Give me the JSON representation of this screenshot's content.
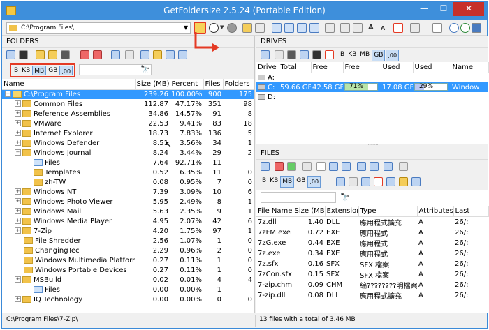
{
  "window": {
    "title": "GetFoldersize 2.5.24 (Portable Edition)",
    "minimize_glyph": "—",
    "maximize_glyph": "☐",
    "close_glyph": "✕"
  },
  "toolbar": {
    "path": "C:\\Program Files\\",
    "font_up": "A",
    "font_down": "A"
  },
  "folders_panel": {
    "title": "FOLDERS",
    "units": [
      "B",
      "KB",
      "MB",
      "GB",
      ",00"
    ],
    "selected_unit": "MB",
    "columns": [
      "Name",
      "Size (MB)",
      "Percent",
      "Files",
      "Folders"
    ],
    "rows": [
      {
        "name": "C:\\Program Files",
        "size": "239.26",
        "percent": "100.00%",
        "files": "900",
        "folders": "175"
      },
      {
        "name": "Common Files",
        "size": "112.87",
        "percent": "47.17%",
        "files": "351",
        "folders": "98"
      },
      {
        "name": "Reference Assemblies",
        "size": "34.86",
        "percent": "14.57%",
        "files": "91",
        "folders": "8"
      },
      {
        "name": "VMware",
        "size": "22.53",
        "percent": "9.41%",
        "files": "83",
        "folders": "18"
      },
      {
        "name": "Internet Explorer",
        "size": "18.73",
        "percent": "7.83%",
        "files": "136",
        "folders": "5"
      },
      {
        "name": "Windows Defender",
        "size": "8.51",
        "percent": "3.56%",
        "files": "34",
        "folders": "1"
      },
      {
        "name": "Windows Journal",
        "size": "8.24",
        "percent": "3.44%",
        "files": "29",
        "folders": "2"
      },
      {
        "name": "Files",
        "size": "7.64",
        "percent": "92.71%",
        "files": "11",
        "folders": ""
      },
      {
        "name": "Templates",
        "size": "0.52",
        "percent": "6.35%",
        "files": "11",
        "folders": "0"
      },
      {
        "name": "zh-TW",
        "size": "0.08",
        "percent": "0.95%",
        "files": "7",
        "folders": "0"
      },
      {
        "name": "Windows NT",
        "size": "7.39",
        "percent": "3.09%",
        "files": "10",
        "folders": "6"
      },
      {
        "name": "Windows Photo Viewer",
        "size": "5.95",
        "percent": "2.49%",
        "files": "8",
        "folders": "1"
      },
      {
        "name": "Windows Mail",
        "size": "5.63",
        "percent": "2.35%",
        "files": "9",
        "folders": "1"
      },
      {
        "name": "Windows Media Player",
        "size": "4.95",
        "percent": "2.07%",
        "files": "42",
        "folders": "6"
      },
      {
        "name": "7-Zip",
        "size": "4.20",
        "percent": "1.75%",
        "files": "97",
        "folders": "1"
      },
      {
        "name": "File Shredder",
        "size": "2.56",
        "percent": "1.07%",
        "files": "1",
        "folders": "0"
      },
      {
        "name": "ChangingTec",
        "size": "2.29",
        "percent": "0.96%",
        "files": "2",
        "folders": "0"
      },
      {
        "name": "Windows Multimedia Platform",
        "size": "0.27",
        "percent": "0.11%",
        "files": "1",
        "folders": "0"
      },
      {
        "name": "Windows Portable Devices",
        "size": "0.27",
        "percent": "0.11%",
        "files": "1",
        "folders": "0"
      },
      {
        "name": "MSBuild",
        "size": "0.02",
        "percent": "0.01%",
        "files": "4",
        "folders": "4"
      },
      {
        "name": "Files",
        "size": "0.00",
        "percent": "0.00%",
        "files": "1",
        "folders": ""
      },
      {
        "name": "IQ Technology",
        "size": "0.00",
        "percent": "0.00%",
        "files": "0",
        "folders": "0"
      }
    ]
  },
  "drives_panel": {
    "title": "DRIVES",
    "units": [
      "B",
      "KB",
      "MB",
      "GB",
      ",00"
    ],
    "selected_unit": "GB",
    "columns": [
      "Drive",
      "Total",
      "Free",
      "Free",
      "Used",
      "Used",
      "Name"
    ],
    "rows": [
      {
        "drive": "A:",
        "total": "",
        "free": "",
        "free_pct": "",
        "used": "",
        "used_pct": "",
        "name": ""
      },
      {
        "drive": "C:",
        "total": "59.66 GB",
        "free": "42.58 GB",
        "free_pct": "71%",
        "used": "17.08 GB",
        "used_pct": "29%",
        "name": "Window"
      },
      {
        "drive": "D:",
        "total": "",
        "free": "",
        "free_pct": "",
        "used": "",
        "used_pct": "",
        "name": ""
      }
    ]
  },
  "files_panel": {
    "title": "FILES",
    "units": [
      "B",
      "KB",
      "MB",
      "GB",
      ",00"
    ],
    "selected_unit": "MB",
    "columns": [
      "File Name",
      "Size (MB)",
      "Extension",
      "Type",
      "Attributes",
      "Last"
    ],
    "rows": [
      {
        "name": "7z.dll",
        "size": "1.40",
        "ext": "DLL",
        "type": "應用程式擴充",
        "attr": "A",
        "last": "26/:"
      },
      {
        "name": "7zFM.exe",
        "size": "0.72",
        "ext": "EXE",
        "type": "應用程式",
        "attr": "A",
        "last": "26/:"
      },
      {
        "name": "7zG.exe",
        "size": "0.44",
        "ext": "EXE",
        "type": "應用程式",
        "attr": "A",
        "last": "26/:"
      },
      {
        "name": "7z.exe",
        "size": "0.34",
        "ext": "EXE",
        "type": "應用程式",
        "attr": "A",
        "last": "26/:"
      },
      {
        "name": "7z.sfx",
        "size": "0.16",
        "ext": "SFX",
        "type": "SFX 檔案",
        "attr": "A",
        "last": "26/:"
      },
      {
        "name": "7zCon.sfx",
        "size": "0.15",
        "ext": "SFX",
        "type": "SFX 檔案",
        "attr": "A",
        "last": "26/:"
      },
      {
        "name": "7-zip.chm",
        "size": "0.09",
        "ext": "CHM",
        "type": "編????????明檔案",
        "attr": "A",
        "last": "26/:"
      },
      {
        "name": "7-zip.dll",
        "size": "0.08",
        "ext": "DLL",
        "type": "應用程式擴充",
        "attr": "A",
        "last": "26/:"
      }
    ]
  },
  "status": {
    "left": "C:\\Program Files\\7-Zip\\",
    "right": "13 files with a total of 3.46 MB"
  }
}
